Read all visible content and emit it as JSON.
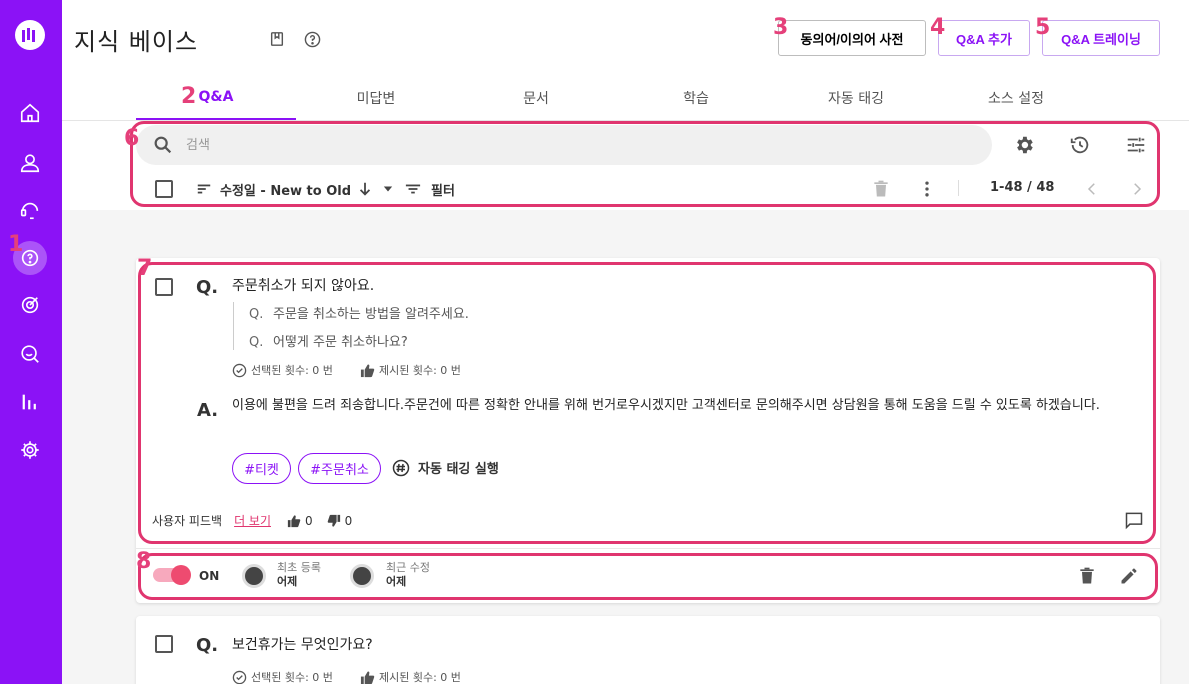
{
  "colors": {
    "brand": "#8b12f6",
    "annotation": "#e0356f",
    "toggle_on": "#ee4b70"
  },
  "sidebar": {
    "items": [
      {
        "icon": "home-icon"
      },
      {
        "icon": "user-icon"
      },
      {
        "icon": "chat-support-icon"
      },
      {
        "icon": "knowledge-icon",
        "active": true
      },
      {
        "icon": "target-icon"
      },
      {
        "icon": "search-chat-icon"
      },
      {
        "icon": "bar-chart-icon"
      },
      {
        "icon": "gear-icon"
      }
    ]
  },
  "header": {
    "title": "지식 베이스",
    "buttons": {
      "synonym_dict": "동의어/이의어 사전",
      "add_qa": "Q&A 추가",
      "qa_training": "Q&A 트레이닝"
    }
  },
  "annotations": {
    "n1": "1",
    "n2": "2",
    "n3": "3",
    "n4": "4",
    "n5": "5",
    "n6": "6",
    "n7": "7",
    "n8": "8"
  },
  "tabs": [
    {
      "label": "Q&A",
      "active": true
    },
    {
      "label": "미답변"
    },
    {
      "label": "문서"
    },
    {
      "label": "학습"
    },
    {
      "label": "자동 태깅"
    },
    {
      "label": "소스 설정"
    }
  ],
  "toolbar": {
    "search_placeholder": "검색",
    "sort_label": "수정일 - New to Old",
    "filter_label": "필터",
    "pager": "1-48 / 48"
  },
  "qa_item": {
    "q_mark": "Q.",
    "question": "주문취소가 되지 않아요.",
    "sub_questions": [
      {
        "q": "Q.",
        "text": "주문을 취소하는 방법을 알려주세요."
      },
      {
        "q": "Q.",
        "text": "어떻게 주문 취소하나요?"
      }
    ],
    "selected_count": "선택된 횟수: 0 번",
    "suggested_count": "제시된 횟수: 0 번",
    "a_mark": "A.",
    "answer": "이용에 불편을 드려 죄송합니다.주문건에 따른 정확한 안내를 위해 번거로우시겠지만 고객센터로 문의해주시면 상담원을 통해 도움을 드릴 수 있도록 하겠습니다.",
    "tags": [
      "#티켓",
      "#주문취소"
    ],
    "auto_tag_label": "자동 태깅 실행",
    "feedback_label": "사용자 피드백",
    "more_label": "더 보기",
    "likes": "0",
    "dislikes": "0",
    "toggle_label": "ON",
    "created_label": "최초 등록",
    "created_value": "어제",
    "modified_label": "최근 수정",
    "modified_value": "어제"
  },
  "qa_item2": {
    "q_mark": "Q.",
    "question": "보건휴가는 무엇인가요?",
    "selected_count": "선택된 횟수: 0 번",
    "suggested_count": "제시된 횟수: 0 번"
  }
}
